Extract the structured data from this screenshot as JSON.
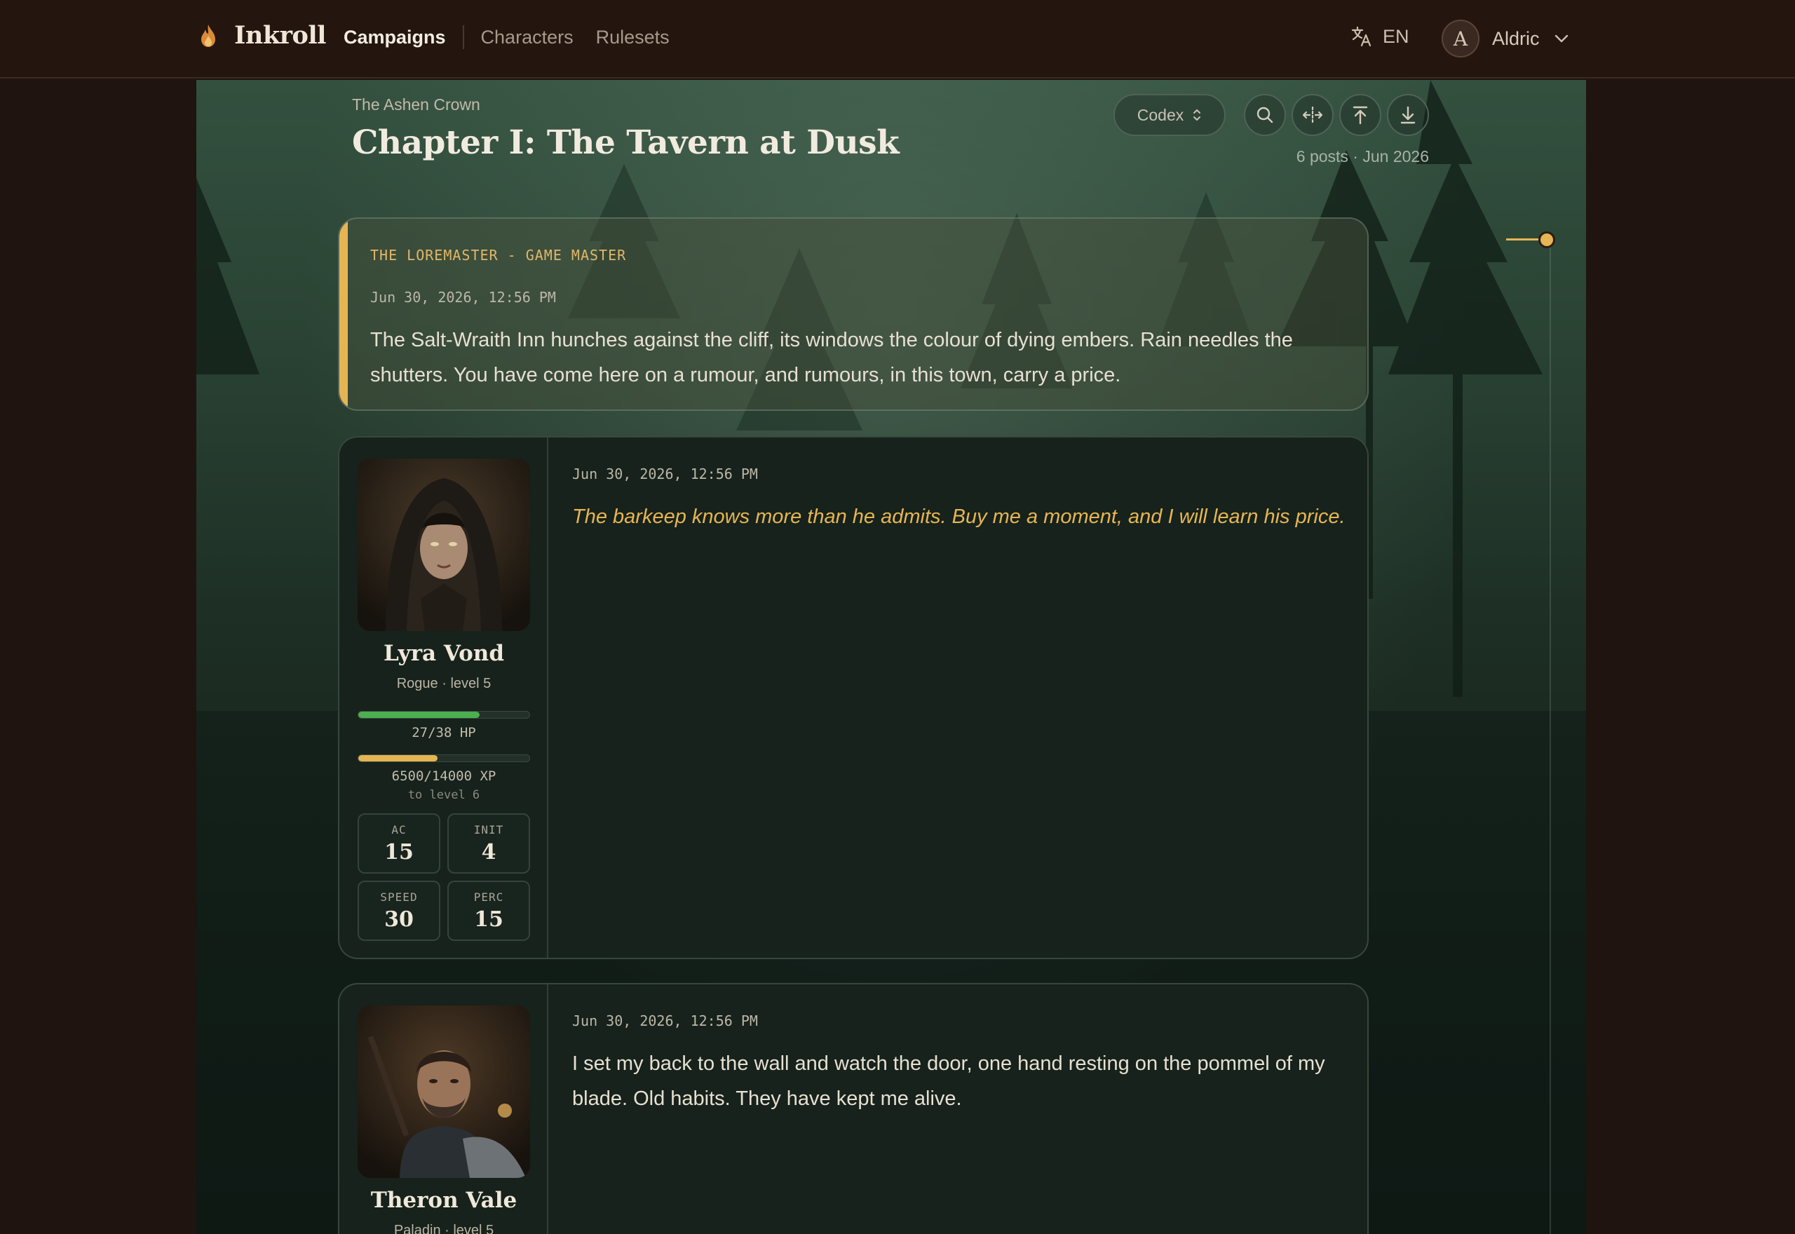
{
  "nav": {
    "brand": "Inkroll",
    "links": [
      {
        "label": "Campaigns",
        "active": true
      },
      {
        "label": "Characters",
        "active": false
      },
      {
        "label": "Rulesets",
        "active": false
      }
    ],
    "language": "EN",
    "user": {
      "initial": "A",
      "name": "Aldric"
    }
  },
  "chapter": {
    "campaign": "The Ashen Crown",
    "title": "Chapter I: The Tavern at Dusk",
    "view_mode": "Codex",
    "meta": "6 posts · Jun 2026"
  },
  "toolbar": {
    "icons": [
      "search-icon",
      "expand-width-icon",
      "jump-to-top-icon",
      "download-icon"
    ]
  },
  "gm_post": {
    "author": "THE LOREMASTER - GAME MASTER",
    "timestamp": "Jun 30, 2026, 12:56 PM",
    "text": "The Salt-Wraith Inn hunches against the cliff, its windows the colour of dying embers. Rain needles the shutters. You have come here on a rumour, and rumours, in this town, carry a price."
  },
  "posts": [
    {
      "character": {
        "name": "Lyra Vond",
        "class_level": "Rogue · level 5",
        "hp_label": "27/38 HP",
        "hp_fraction": 0.7105,
        "xp_label": "6500/14000 XP",
        "xp_fraction": 0.4643,
        "xp_sub": "to level 6",
        "stats": [
          {
            "label": "AC",
            "value": "15"
          },
          {
            "label": "INIT",
            "value": "4"
          },
          {
            "label": "SPEED",
            "value": "30"
          },
          {
            "label": "PERC",
            "value": "15"
          }
        ]
      },
      "timestamp": "Jun 30, 2026, 12:56 PM",
      "text": "The barkeep knows more than he admits. Buy me a moment, and I will learn his price.",
      "style": "speech"
    },
    {
      "character": {
        "name": "Theron Vale",
        "class_level": "Paladin · level 5"
      },
      "timestamp": "Jun 30, 2026, 12:56 PM",
      "text": "I set my back to the wall and watch the door, one hand resting on the pommel of my blade. Old habits. They have kept me alive.",
      "style": "narration"
    }
  ],
  "colors": {
    "accent_gold": "#e6b553",
    "hp_green": "#4caf50",
    "nav_bg": "#24160f"
  }
}
